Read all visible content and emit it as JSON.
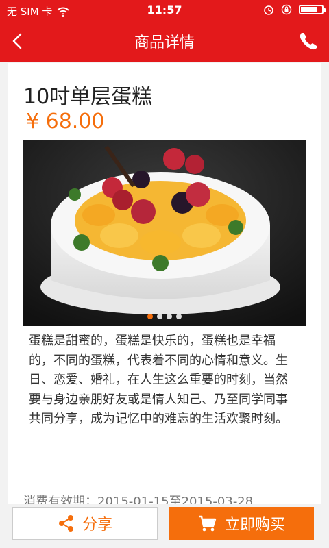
{
  "status_bar": {
    "carrier": "无 SIM 卡",
    "time": "11:57",
    "icons": [
      "wifi-icon",
      "alarm-icon",
      "rotation-lock-icon",
      "battery-icon"
    ],
    "battery_level": 0.85
  },
  "nav": {
    "title": "商品详情",
    "back_icon": "chevron-left-icon",
    "phone_icon": "phone-icon"
  },
  "product": {
    "name": "10吋单层蛋糕",
    "price": "¥ 68.00",
    "image": "cake-with-fruit-photo",
    "carousel_total": 4,
    "carousel_active": 1,
    "description": "蛋糕是甜蜜的，蛋糕是快乐的，蛋糕也是幸福的，不同的蛋糕，代表着不同的心情和意义。生日、恋爱、婚礼，在人生这么重要的时刻，当然要与身边亲朋好友或是情人知己、乃至同学同事共同分享，成为记忆中的难忘的生活欢聚时刻。",
    "validity": "消费有效期：2015-01-15至2015-03-28"
  },
  "actions": {
    "share_label": "分享",
    "buy_label": "立即购买"
  },
  "colors": {
    "header_red": "#e3191b",
    "accent_orange": "#f56e0c"
  }
}
